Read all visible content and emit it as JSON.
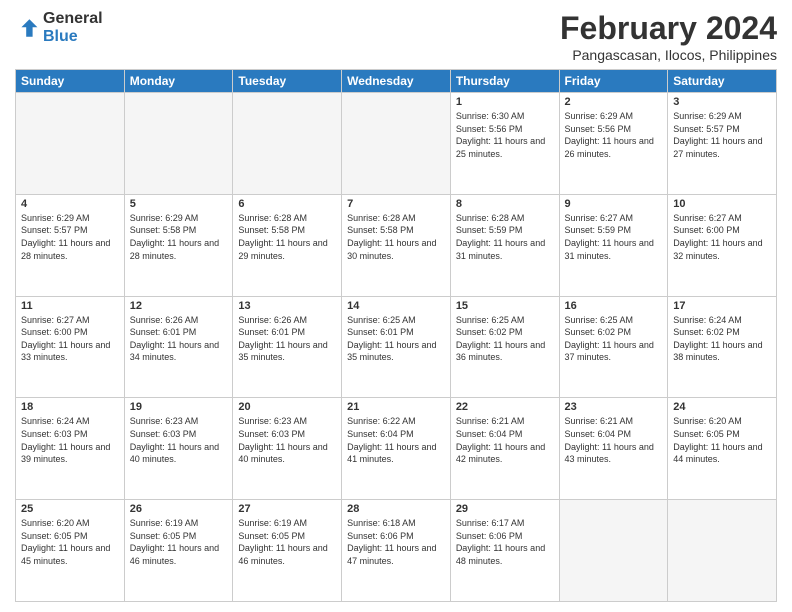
{
  "header": {
    "logo_general": "General",
    "logo_blue": "Blue",
    "title": "February 2024",
    "location": "Pangascasan, Ilocos, Philippines"
  },
  "days_of_week": [
    "Sunday",
    "Monday",
    "Tuesday",
    "Wednesday",
    "Thursday",
    "Friday",
    "Saturday"
  ],
  "weeks": [
    [
      {
        "day": "",
        "info": ""
      },
      {
        "day": "",
        "info": ""
      },
      {
        "day": "",
        "info": ""
      },
      {
        "day": "",
        "info": ""
      },
      {
        "day": "1",
        "info": "Sunrise: 6:30 AM\nSunset: 5:56 PM\nDaylight: 11 hours and 25 minutes."
      },
      {
        "day": "2",
        "info": "Sunrise: 6:29 AM\nSunset: 5:56 PM\nDaylight: 11 hours and 26 minutes."
      },
      {
        "day": "3",
        "info": "Sunrise: 6:29 AM\nSunset: 5:57 PM\nDaylight: 11 hours and 27 minutes."
      }
    ],
    [
      {
        "day": "4",
        "info": "Sunrise: 6:29 AM\nSunset: 5:57 PM\nDaylight: 11 hours and 28 minutes."
      },
      {
        "day": "5",
        "info": "Sunrise: 6:29 AM\nSunset: 5:58 PM\nDaylight: 11 hours and 28 minutes."
      },
      {
        "day": "6",
        "info": "Sunrise: 6:28 AM\nSunset: 5:58 PM\nDaylight: 11 hours and 29 minutes."
      },
      {
        "day": "7",
        "info": "Sunrise: 6:28 AM\nSunset: 5:58 PM\nDaylight: 11 hours and 30 minutes."
      },
      {
        "day": "8",
        "info": "Sunrise: 6:28 AM\nSunset: 5:59 PM\nDaylight: 11 hours and 31 minutes."
      },
      {
        "day": "9",
        "info": "Sunrise: 6:27 AM\nSunset: 5:59 PM\nDaylight: 11 hours and 31 minutes."
      },
      {
        "day": "10",
        "info": "Sunrise: 6:27 AM\nSunset: 6:00 PM\nDaylight: 11 hours and 32 minutes."
      }
    ],
    [
      {
        "day": "11",
        "info": "Sunrise: 6:27 AM\nSunset: 6:00 PM\nDaylight: 11 hours and 33 minutes."
      },
      {
        "day": "12",
        "info": "Sunrise: 6:26 AM\nSunset: 6:01 PM\nDaylight: 11 hours and 34 minutes."
      },
      {
        "day": "13",
        "info": "Sunrise: 6:26 AM\nSunset: 6:01 PM\nDaylight: 11 hours and 35 minutes."
      },
      {
        "day": "14",
        "info": "Sunrise: 6:25 AM\nSunset: 6:01 PM\nDaylight: 11 hours and 35 minutes."
      },
      {
        "day": "15",
        "info": "Sunrise: 6:25 AM\nSunset: 6:02 PM\nDaylight: 11 hours and 36 minutes."
      },
      {
        "day": "16",
        "info": "Sunrise: 6:25 AM\nSunset: 6:02 PM\nDaylight: 11 hours and 37 minutes."
      },
      {
        "day": "17",
        "info": "Sunrise: 6:24 AM\nSunset: 6:02 PM\nDaylight: 11 hours and 38 minutes."
      }
    ],
    [
      {
        "day": "18",
        "info": "Sunrise: 6:24 AM\nSunset: 6:03 PM\nDaylight: 11 hours and 39 minutes."
      },
      {
        "day": "19",
        "info": "Sunrise: 6:23 AM\nSunset: 6:03 PM\nDaylight: 11 hours and 40 minutes."
      },
      {
        "day": "20",
        "info": "Sunrise: 6:23 AM\nSunset: 6:03 PM\nDaylight: 11 hours and 40 minutes."
      },
      {
        "day": "21",
        "info": "Sunrise: 6:22 AM\nSunset: 6:04 PM\nDaylight: 11 hours and 41 minutes."
      },
      {
        "day": "22",
        "info": "Sunrise: 6:21 AM\nSunset: 6:04 PM\nDaylight: 11 hours and 42 minutes."
      },
      {
        "day": "23",
        "info": "Sunrise: 6:21 AM\nSunset: 6:04 PM\nDaylight: 11 hours and 43 minutes."
      },
      {
        "day": "24",
        "info": "Sunrise: 6:20 AM\nSunset: 6:05 PM\nDaylight: 11 hours and 44 minutes."
      }
    ],
    [
      {
        "day": "25",
        "info": "Sunrise: 6:20 AM\nSunset: 6:05 PM\nDaylight: 11 hours and 45 minutes."
      },
      {
        "day": "26",
        "info": "Sunrise: 6:19 AM\nSunset: 6:05 PM\nDaylight: 11 hours and 46 minutes."
      },
      {
        "day": "27",
        "info": "Sunrise: 6:19 AM\nSunset: 6:05 PM\nDaylight: 11 hours and 46 minutes."
      },
      {
        "day": "28",
        "info": "Sunrise: 6:18 AM\nSunset: 6:06 PM\nDaylight: 11 hours and 47 minutes."
      },
      {
        "day": "29",
        "info": "Sunrise: 6:17 AM\nSunset: 6:06 PM\nDaylight: 11 hours and 48 minutes."
      },
      {
        "day": "",
        "info": ""
      },
      {
        "day": "",
        "info": ""
      }
    ]
  ]
}
